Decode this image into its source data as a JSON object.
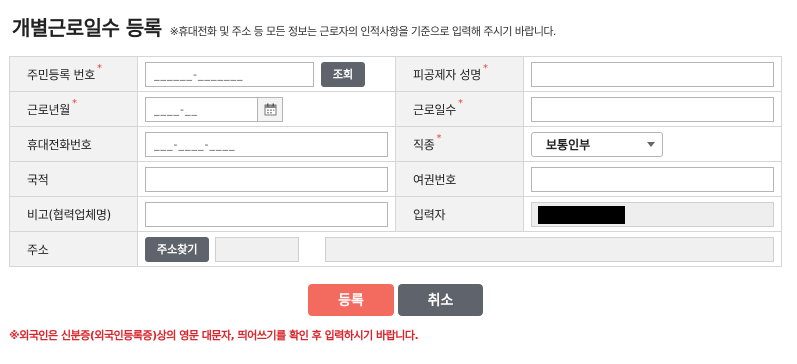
{
  "header": {
    "title": "개별근로일수 등록",
    "note": "※휴대전화 및 주소 등 모든 정보는 근로자의 인적사항을 기준으로 입력해 주시기 바랍니다."
  },
  "form": {
    "resident_number": {
      "label": "주민등록 번호",
      "required_mark": "*",
      "placeholder": "______-_______",
      "lookup_button": "조회"
    },
    "insured_name": {
      "label": "피공제자 성명",
      "required_mark": "*",
      "value": ""
    },
    "work_month": {
      "label": "근로년월",
      "required_mark": "*",
      "placeholder": "____-__"
    },
    "work_days": {
      "label": "근로일수",
      "required_mark": "*",
      "value": ""
    },
    "mobile": {
      "label": "휴대전화번호",
      "placeholder": "___-____-____"
    },
    "job_type": {
      "label": "직종",
      "required_mark": "*",
      "selected": "보통인부"
    },
    "nationality": {
      "label": "국적",
      "value": ""
    },
    "passport": {
      "label": "여권번호",
      "value": ""
    },
    "remarks": {
      "label": "비고(협력업체명)",
      "value": ""
    },
    "entered_by": {
      "label": "입력자"
    },
    "address": {
      "label": "주소",
      "search_button": "주소찾기",
      "zipcode": "",
      "detail": ""
    }
  },
  "actions": {
    "submit": "등록",
    "cancel": "취소"
  },
  "footnote": "※외국인은 신분증(외국인등록증)상의 영문 대문자, 띄어쓰기를 확인 후 입력하시기 바랍니다.",
  "icons": {
    "calendar": "calendar-icon",
    "dropdown": "chevron-down-icon"
  },
  "colors": {
    "primary": "#f36a5f",
    "dark_button": "#5f636b",
    "required": "#e0463e",
    "footnote": "#d9262c"
  }
}
